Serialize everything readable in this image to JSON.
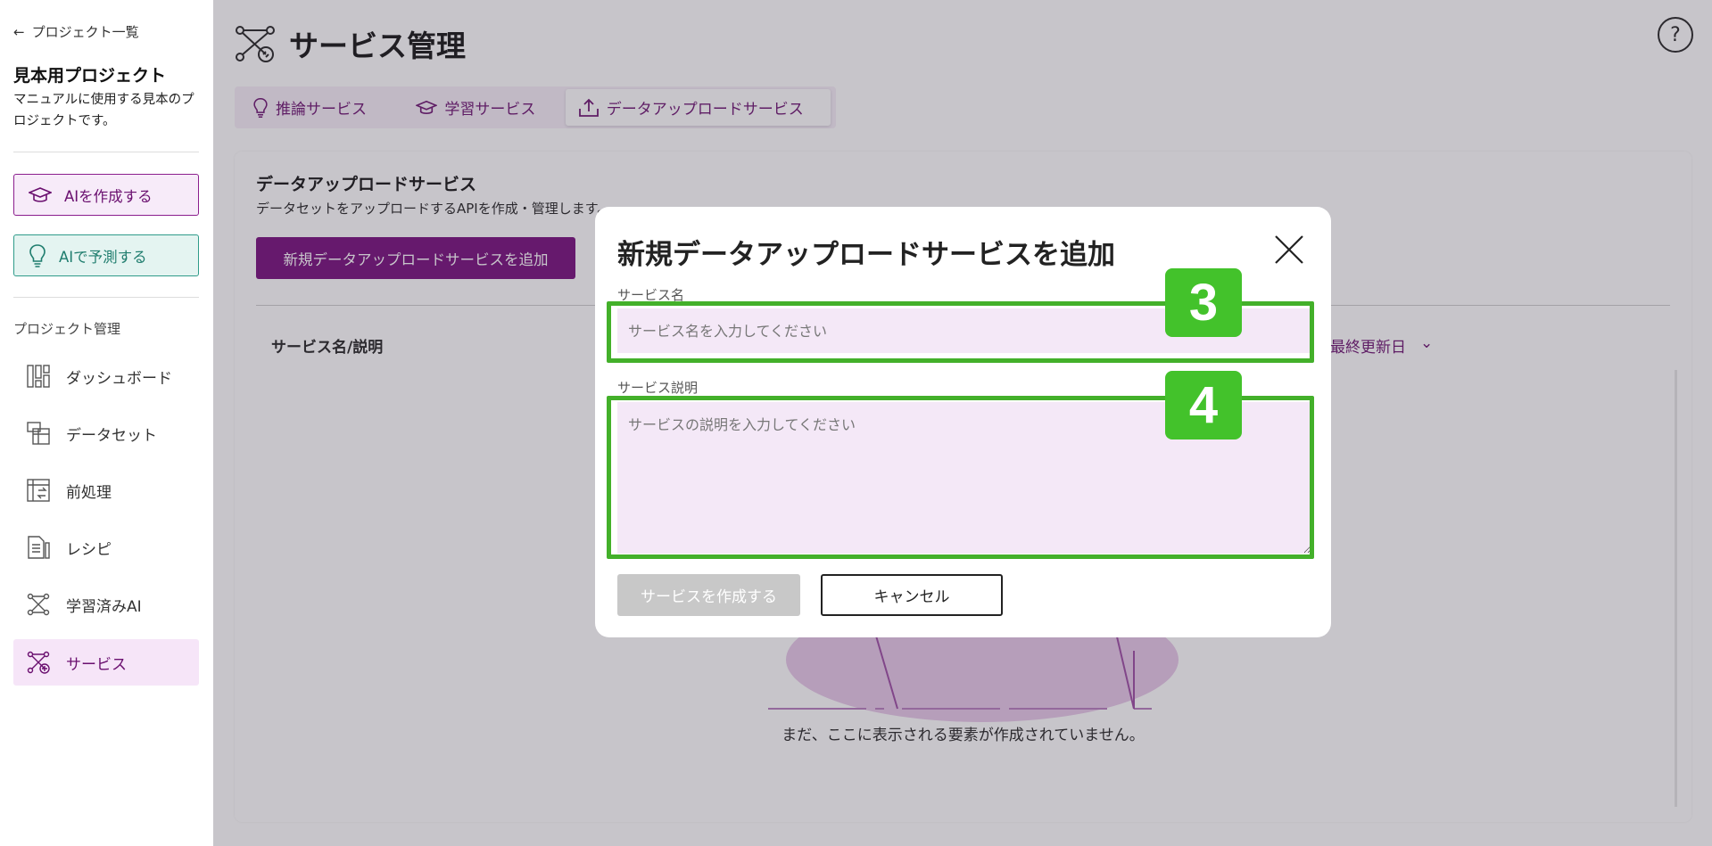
{
  "sidebar": {
    "back_label": "プロジェクト一覧",
    "project_title": "見本用プロジェクト",
    "project_desc": "マニュアルに使用する見本のプロジェクトです。",
    "create_ai_label": "AIを作成する",
    "predict_ai_label": "AIで予測する",
    "section_label": "プロジェクト管理",
    "items": [
      {
        "label": "ダッシュボード",
        "icon": "dashboard-icon"
      },
      {
        "label": "データセット",
        "icon": "dataset-icon"
      },
      {
        "label": "前処理",
        "icon": "preprocess-icon"
      },
      {
        "label": "レシピ",
        "icon": "recipe-icon"
      },
      {
        "label": "学習済みAI",
        "icon": "trained-ai-icon"
      },
      {
        "label": "サービス",
        "icon": "service-icon",
        "active": true
      }
    ]
  },
  "header": {
    "title": "サービス管理",
    "help_label": "?"
  },
  "tabs": [
    {
      "label": "推論サービス",
      "icon": "lightbulb-icon"
    },
    {
      "label": "学習サービス",
      "icon": "graduation-cap-icon"
    },
    {
      "label": "データアップロードサービス",
      "icon": "upload-icon",
      "active": true
    }
  ],
  "card": {
    "title": "データアップロードサービス",
    "subtitle": "データセットをアップロードするAPIを作成・管理します。",
    "add_button": "新規データアップロードサービスを追加",
    "col_name": "サービス名/説明",
    "col_date": "最終更新日",
    "empty_message": "まだ、ここに表示される要素が作成されていません。"
  },
  "modal": {
    "title": "新規データアップロードサービスを追加",
    "name_label": "サービス名",
    "name_placeholder": "サービス名を入力してください",
    "name_value": "",
    "desc_label": "サービス説明",
    "desc_placeholder": "サービスの説明を入力してください",
    "desc_value": "",
    "create_button": "サービスを作成する",
    "cancel_button": "キャンセル"
  },
  "annotations": {
    "badge_name": "3",
    "badge_desc": "4",
    "highlight_color": "#43b02a"
  },
  "colors": {
    "brand": "#74097a",
    "teal": "#2f9b8a",
    "disabled": "#c8c8c8"
  }
}
